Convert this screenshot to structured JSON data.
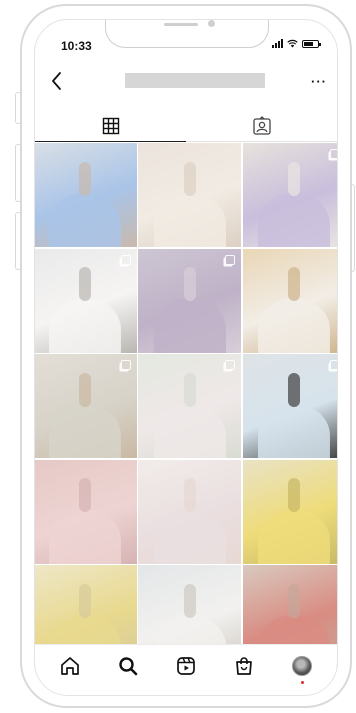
{
  "status_bar": {
    "time": "10:33"
  },
  "header": {
    "more_label": "···"
  },
  "tabs": [
    {
      "name": "posts-grid",
      "icon": "grid-icon",
      "active": true
    },
    {
      "name": "tagged",
      "icon": "tagged-person-icon",
      "active": false
    }
  ],
  "posts": [
    {
      "colors": [
        "#d9dfe6",
        "#a9c4e8",
        "#c9b9ad"
      ],
      "multi": false
    },
    {
      "colors": [
        "#ece4dc",
        "#f1ebe3",
        "#dcd0c3"
      ],
      "multi": false
    },
    {
      "colors": [
        "#e8e2dc",
        "#c9bedc",
        "#e9e6e3"
      ],
      "multi": true
    },
    {
      "colors": [
        "#e9eaea",
        "#f6f4f3",
        "#b9b6b2"
      ],
      "multi": true
    },
    {
      "colors": [
        "#cdc6d3",
        "#bfb2c8",
        "#d8cfd9"
      ],
      "multi": true
    },
    {
      "colors": [
        "#e9d6b6",
        "#f2ede6",
        "#cdb48b"
      ],
      "multi": false
    },
    {
      "colors": [
        "#e3ded6",
        "#d7d3c9",
        "#c9b9a3"
      ],
      "multi": true
    },
    {
      "colors": [
        "#e4e8e0",
        "#efe8e8",
        "#d9dcd3"
      ],
      "multi": true
    },
    {
      "colors": [
        "#dfe3e6",
        "#d6e3ec",
        "#3f3f3f"
      ],
      "multi": true
    },
    {
      "colors": [
        "#e6c9c6",
        "#edd4d2",
        "#d6b3b3"
      ],
      "multi": false
    },
    {
      "colors": [
        "#f1ecea",
        "#eadfe0",
        "#e7d8d3"
      ],
      "multi": false
    },
    {
      "colors": [
        "#e9e2c5",
        "#eedc7a",
        "#c7b865"
      ],
      "multi": false
    },
    {
      "colors": [
        "#eee7c7",
        "#e8d98e",
        "#d7ca9a"
      ],
      "multi": false
    },
    {
      "colors": [
        "#e3e6e8",
        "#f2f1ef",
        "#cfcac3"
      ],
      "multi": false
    },
    {
      "colors": [
        "#d9c9bf",
        "#d98c82",
        "#c6a79a"
      ],
      "multi": false
    }
  ],
  "bottom_nav": [
    {
      "name": "nav-home",
      "icon": "home-icon"
    },
    {
      "name": "nav-search",
      "icon": "search-icon"
    },
    {
      "name": "nav-reels",
      "icon": "reels-icon"
    },
    {
      "name": "nav-shop",
      "icon": "shop-bag-icon"
    },
    {
      "name": "nav-profile",
      "icon": "profile-avatar",
      "has_notification": true
    }
  ],
  "accent": {
    "notification_dot": "#e03030"
  }
}
